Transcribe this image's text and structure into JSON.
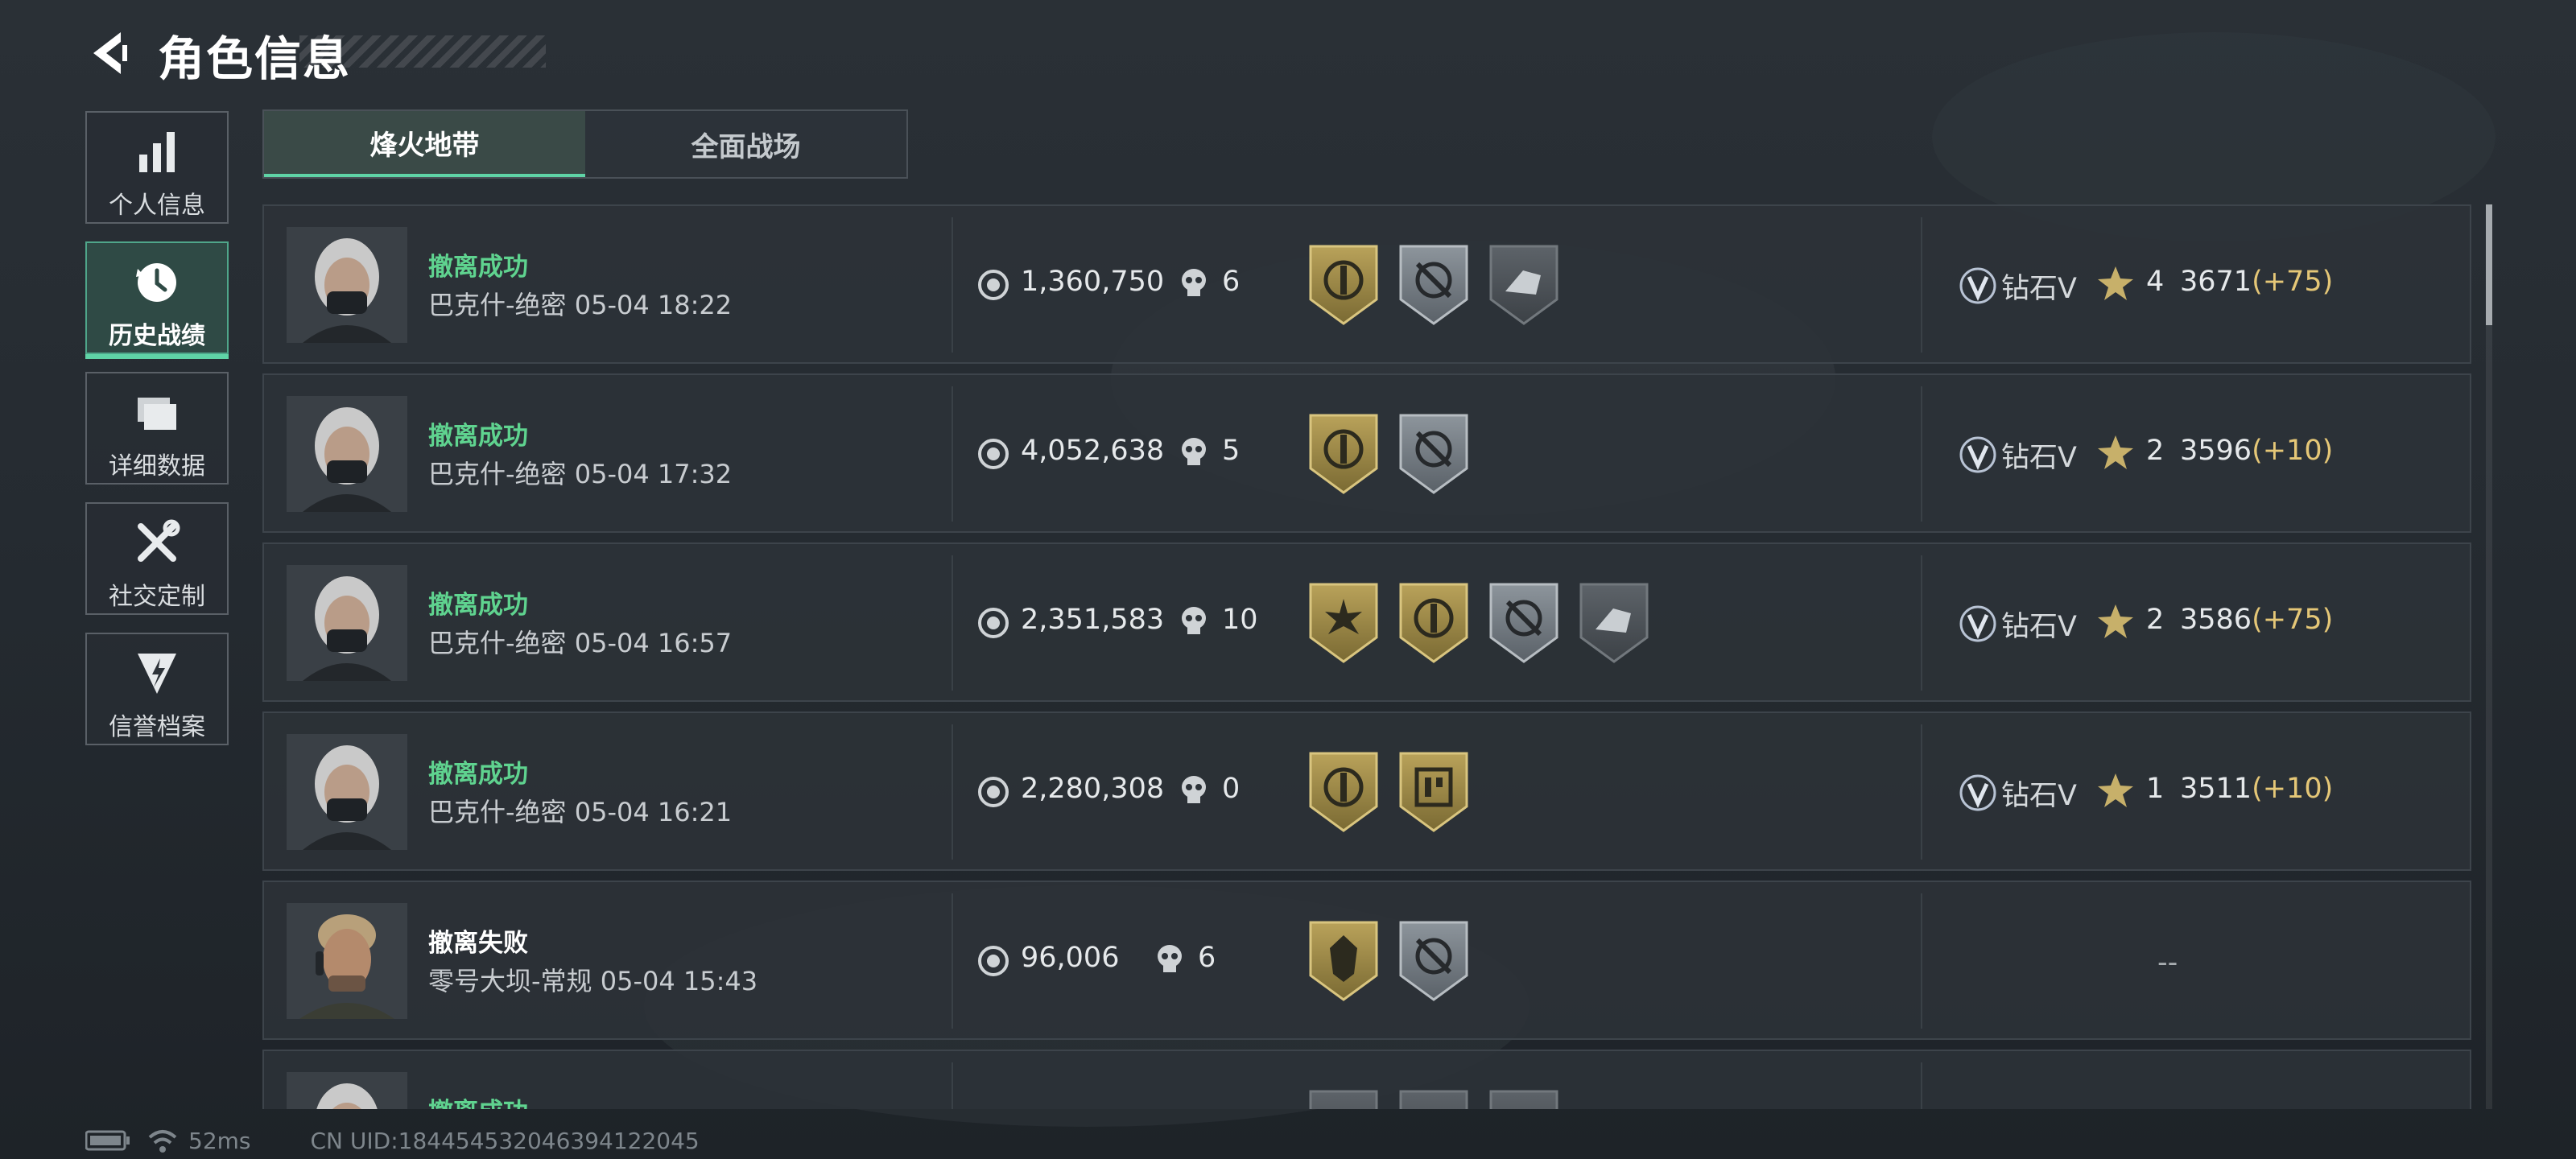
{
  "header": {
    "title": "角色信息"
  },
  "sidebar": {
    "items": [
      {
        "label": "个人信息",
        "icon": "bar-chart-icon",
        "active": false
      },
      {
        "label": "历史战绩",
        "icon": "clock-history-icon",
        "active": true
      },
      {
        "label": "详细数据",
        "icon": "folder-icon",
        "active": false
      },
      {
        "label": "社交定制",
        "icon": "tools-icon",
        "active": false
      },
      {
        "label": "信誉档案",
        "icon": "reputation-icon",
        "active": false
      }
    ]
  },
  "tabs": [
    {
      "label": "烽火地带",
      "active": true
    },
    {
      "label": "全面战场",
      "active": false
    }
  ],
  "records": [
    {
      "status": "撤离成功",
      "map_time": "巴克什-绝密 05-04 18:22",
      "value": "1,360,750",
      "kills": "6",
      "badges": [
        "gold-emblem-badge",
        "silver-crosshair-badge",
        "grey-vehicle-badge"
      ],
      "rank": "钻石V",
      "stars": "4",
      "score": "3671",
      "delta": "(+75)"
    },
    {
      "status": "撤离成功",
      "map_time": "巴克什-绝密 05-04 17:32",
      "value": "4,052,638",
      "kills": "5",
      "badges": [
        "gold-emblem-badge",
        "silver-crosshair-badge"
      ],
      "rank": "钻石V",
      "stars": "2",
      "score": "3596",
      "delta": "(+10)"
    },
    {
      "status": "撤离成功",
      "map_time": "巴克什-绝密 05-04 16:57",
      "value": "2,351,583",
      "kills": "10",
      "badges": [
        "gold-starburst-badge",
        "gold-emblem-badge",
        "silver-crosshair-badge",
        "grey-vehicle-badge"
      ],
      "rank": "钻石V",
      "stars": "2",
      "score": "3586",
      "delta": "(+75)"
    },
    {
      "status": "撤离成功",
      "map_time": "巴克什-绝密 05-04 16:21",
      "value": "2,280,308",
      "kills": "0",
      "badges": [
        "gold-emblem-badge",
        "gold-building-badge"
      ],
      "rank": "钻石V",
      "stars": "1",
      "score": "3511",
      "delta": "(+10)"
    },
    {
      "status": "撤离失败",
      "map_time": "零号大坝-常规 05-04 15:43",
      "value": "96,006",
      "kills": "6",
      "badges": [
        "gold-helmet-badge",
        "silver-crosshair-badge"
      ],
      "rank": "",
      "stars": "",
      "score": "",
      "delta": "",
      "placeholder": "--"
    },
    {
      "status": "撤离成功",
      "map_time": "",
      "value": "",
      "kills": "",
      "badges": [
        "grey-badge",
        "grey-badge",
        "grey-badge"
      ],
      "rank": "",
      "stars": "",
      "score": "",
      "delta": ""
    }
  ],
  "footer": {
    "ping": "52ms",
    "uid": "CN UID:1844545320463941220​45"
  },
  "colors": {
    "accent": "#5fd3a6",
    "success": "#5fd38f",
    "gold": "#e5c777"
  }
}
